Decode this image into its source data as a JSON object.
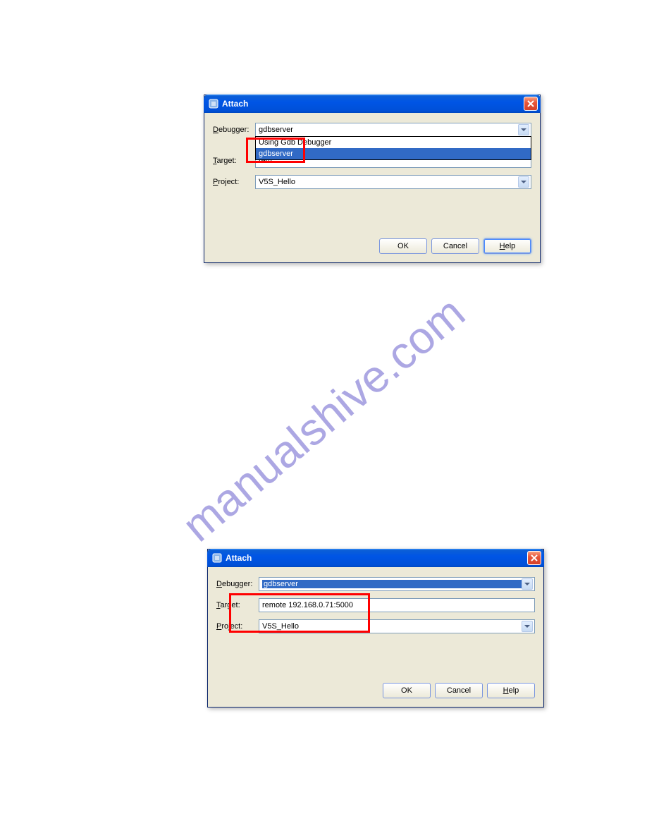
{
  "watermark": "manualshive.com",
  "dialog1": {
    "title": "Attach",
    "labels": {
      "debugger": "Debugger:",
      "target": "Target:",
      "project": "Project:"
    },
    "values": {
      "debugger": "gdbserver",
      "target": "rem",
      "project": "V5S_Hello"
    },
    "dropdown": {
      "item1": "Using Gdb Debugger",
      "item2": "gdbserver"
    },
    "buttons": {
      "ok": "OK",
      "cancel": "Cancel",
      "help": "Help"
    }
  },
  "dialog2": {
    "title": "Attach",
    "labels": {
      "debugger": "Debugger:",
      "target": "Target:",
      "project": "Project:"
    },
    "values": {
      "debugger": "gdbserver",
      "target": "remote 192.168.0.71:5000",
      "project": "V5S_Hello"
    },
    "buttons": {
      "ok": "OK",
      "cancel": "Cancel",
      "help": "Help"
    }
  }
}
